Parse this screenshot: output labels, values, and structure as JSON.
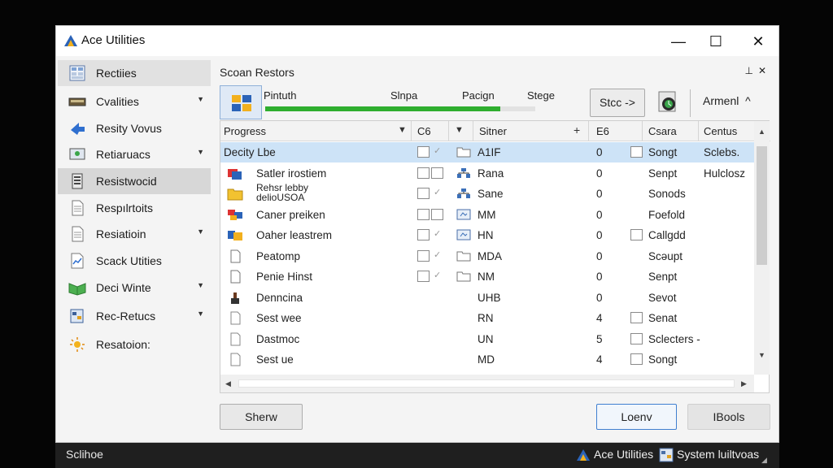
{
  "window": {
    "title": "Ace Utilities",
    "minimize": "—",
    "maximize": "☐",
    "close": "✕"
  },
  "sidebar": {
    "items": [
      {
        "label": "Rectiies",
        "icon": "calculator-icon",
        "caret": false,
        "selected": true
      },
      {
        "label": "Cvalities",
        "icon": "drive-icon",
        "caret": true
      },
      {
        "label": "Resity Vovus",
        "icon": "arrow-icon",
        "caret": false
      },
      {
        "label": "Retiaruacs",
        "icon": "monitor-icon",
        "caret": true
      },
      {
        "label": "Resistwocid",
        "icon": "server-icon",
        "caret": false,
        "selected": true
      },
      {
        "label": "Respılrtoits",
        "icon": "document-icon",
        "caret": false
      },
      {
        "label": "Resiatioin",
        "icon": "document-icon",
        "caret": true
      },
      {
        "label": "Scack Utities",
        "icon": "chart-icon",
        "caret": false
      },
      {
        "label": "Deci Winte",
        "icon": "book-icon",
        "caret": true
      },
      {
        "label": "Rec-Retucs",
        "icon": "registry-icon",
        "caret": true
      },
      {
        "label": "Resatoion:",
        "icon": "sun-icon",
        "caret": false
      }
    ],
    "caret_glyph": "▼"
  },
  "pane": {
    "title": "Scoan Restors",
    "ctrl_pin": "⊥",
    "ctrl_close": "✕"
  },
  "toolbar": {
    "col1": "Pintuth",
    "col2": "Slnpa",
    "col3": "Pacign",
    "col4": "Stege",
    "progress": 0.87,
    "stop_label": "Stcc ->",
    "armen_label": "Armenl",
    "armen_caret": "^"
  },
  "table": {
    "headers": {
      "progress": "Progress",
      "c6": "C6",
      "sitner": "Sitner",
      "e6": "E6",
      "csara": "Csara",
      "centus": "Centus"
    },
    "sort_glyph": "▼",
    "plus_glyph": "+",
    "rows": [
      {
        "name": "Decity Lbe",
        "box1": true,
        "tick": "✓",
        "folder": "folder",
        "code": "A1IF",
        "num": "0",
        "box2": true,
        "status": "Songt",
        "extra": "Sclebs."
      },
      {
        "name": "Satler irostiem",
        "box1": true,
        "tick": "",
        "folder": "network",
        "code": "Rana",
        "num": "0",
        "box2": false,
        "status": "Senpt",
        "extra": "Hulclosz"
      },
      {
        "name": "Rehsr lebby\ndelioUSOA",
        "box1": true,
        "tick": "✓",
        "folder": "network",
        "code": "Sane",
        "num": "0",
        "box2": false,
        "status": "Sonods",
        "extra": ""
      },
      {
        "name": "Caner preiken",
        "box1": true,
        "tick": "",
        "folder": "screen",
        "code": "MM",
        "num": "0",
        "box2": false,
        "status": "Foefold",
        "extra": ""
      },
      {
        "name": "Oaher leastrem",
        "box1": true,
        "tick": "✓",
        "folder": "screen",
        "code": "HN",
        "num": "0",
        "box2": true,
        "status": "Callgdd",
        "extra": ""
      },
      {
        "name": "Peatomp",
        "box1": true,
        "tick": "✓",
        "folder": "folder",
        "code": "MDA",
        "num": "0",
        "box2": false,
        "status": "Scəupt",
        "extra": ""
      },
      {
        "name": "Penie Hinst",
        "box1": true,
        "tick": "✓",
        "folder": "folder",
        "code": "NM",
        "num": "0",
        "box2": false,
        "status": "Senpt",
        "extra": ""
      },
      {
        "name": "Denncina",
        "box1": false,
        "tick": "",
        "folder": "",
        "code": "UHB",
        "num": "0",
        "box2": false,
        "status": "Sevot",
        "extra": ""
      },
      {
        "name": "Sest wee",
        "box1": false,
        "tick": "",
        "folder": "",
        "code": "RN",
        "num": "4",
        "box2": true,
        "status": "Senat",
        "extra": ""
      },
      {
        "name": "Dastmoc",
        "box1": false,
        "tick": "",
        "folder": "",
        "code": "UN",
        "num": "5",
        "box2": true,
        "status": "Sclecters -",
        "extra": ""
      },
      {
        "name": "Sest ue",
        "box1": false,
        "tick": "",
        "folder": "",
        "code": "MD",
        "num": "4",
        "box2": true,
        "status": "Songt",
        "extra": ""
      }
    ]
  },
  "buttons": {
    "show": "Sherw",
    "load": "Loenv",
    "tools": "IBools"
  },
  "taskbar": {
    "start": "Sclihoe",
    "app1": "Ace Utilities",
    "app2": "System luiltvoas"
  },
  "colors": {
    "accent": "#3f7fd0",
    "progress": "#2fae2f",
    "selection": "#cde3f7"
  }
}
